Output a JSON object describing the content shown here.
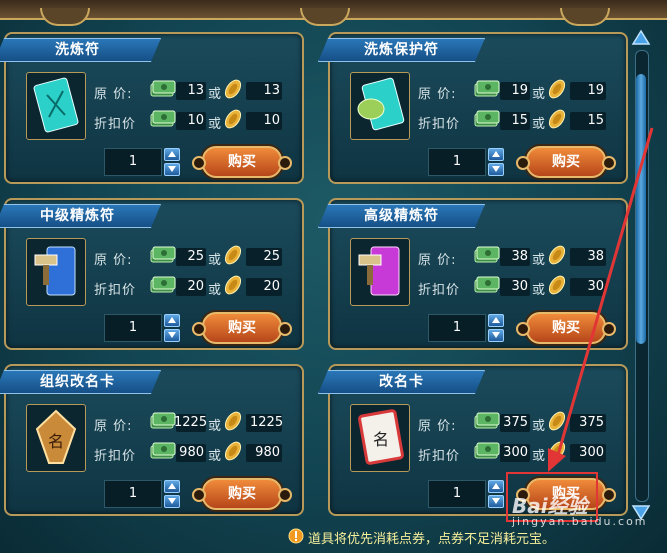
{
  "labels": {
    "original_price": "原 价:",
    "discount_price": "折扣价",
    "or": "或",
    "buy": "购买"
  },
  "items": [
    {
      "name": "洗炼符",
      "orig_cash": "13",
      "orig_gold": "13",
      "disc_cash": "10",
      "disc_gold": "10",
      "qty": "1",
      "icon": "blue-talisman-icon"
    },
    {
      "name": "洗炼保护符",
      "orig_cash": "19",
      "orig_gold": "19",
      "disc_cash": "15",
      "disc_gold": "15",
      "qty": "1",
      "icon": "leaf-talisman-icon"
    },
    {
      "name": "中级精炼符",
      "orig_cash": "25",
      "orig_gold": "25",
      "disc_cash": "20",
      "disc_gold": "20",
      "qty": "1",
      "icon": "hammer-blue-talisman-icon"
    },
    {
      "name": "高级精炼符",
      "orig_cash": "38",
      "orig_gold": "38",
      "disc_cash": "30",
      "disc_gold": "30",
      "qty": "1",
      "icon": "hammer-purple-talisman-icon"
    },
    {
      "name": "组织改名卡",
      "orig_cash": "1225",
      "orig_gold": "1225",
      "disc_cash": "980",
      "disc_gold": "980",
      "qty": "1",
      "icon": "wooden-name-tag-icon"
    },
    {
      "name": "改名卡",
      "orig_cash": "375",
      "orig_gold": "375",
      "disc_cash": "300",
      "disc_gold": "300",
      "qty": "1",
      "icon": "red-name-card-icon"
    }
  ],
  "notice": "道具将优先消耗点券，点券不足消耗元宝。",
  "watermark": {
    "text": "Bai经验",
    "sub": "jingyan.baidu.com"
  },
  "colors": {
    "accent_red": "#e23636",
    "buy_orange": "#e07a32",
    "title_blue": "#2a77b8"
  }
}
